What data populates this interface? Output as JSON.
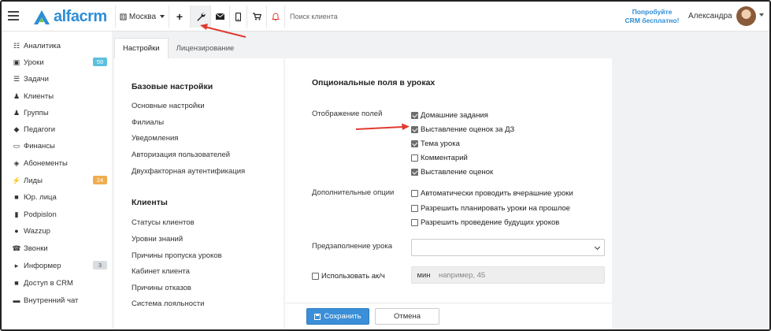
{
  "header": {
    "logo_text": "alfacrm",
    "city": "Москва",
    "search_placeholder": "Поиск клиента",
    "promo_line1": "Попробуйте",
    "promo_line2": "CRM бесплатно!",
    "user_name": "Александра"
  },
  "sidebar": {
    "items": [
      {
        "label": "Аналитика",
        "icon": "chart-book-icon"
      },
      {
        "label": "Уроки",
        "icon": "calendar-icon",
        "badge": "59",
        "badge_color": "#5bc0de"
      },
      {
        "label": "Задачи",
        "icon": "clipboard-icon"
      },
      {
        "label": "Клиенты",
        "icon": "user-icon"
      },
      {
        "label": "Группы",
        "icon": "users-icon"
      },
      {
        "label": "Педагоги",
        "icon": "graduation-cap-icon"
      },
      {
        "label": "Финансы",
        "icon": "money-icon"
      },
      {
        "label": "Абонементы",
        "icon": "tag-icon"
      },
      {
        "label": "Лиды",
        "icon": "lightning-icon",
        "badge": "24",
        "badge_color": "#f0ad4e"
      },
      {
        "label": "Юр. лица",
        "icon": "briefcase-icon"
      },
      {
        "label": "Podpislon",
        "icon": "document-icon"
      },
      {
        "label": "Wazzup",
        "icon": "whatsapp-icon"
      },
      {
        "label": "Звонки",
        "icon": "phone-icon"
      },
      {
        "label": "Информер",
        "icon": "megaphone-icon",
        "badge": "3",
        "badge_color": "#d9dde1"
      },
      {
        "label": "Доступ в CRM",
        "icon": "lock-icon"
      },
      {
        "label": "Внутренний чат",
        "icon": "chat-icon"
      }
    ]
  },
  "tabs": [
    "Настройки",
    "Лицензирование"
  ],
  "settings_nav": {
    "basic_title": "Базовые настройки",
    "basic_links": [
      "Основные настройки",
      "Филиалы",
      "Уведомления",
      "Авторизация пользователей",
      "Двухфакторная аутентификация"
    ],
    "clients_title": "Клиенты",
    "clients_links": [
      "Статусы клиентов",
      "Уровни знаний",
      "Причины пропуска уроков",
      "Кабинет клиента",
      "Причины отказов",
      "Система лояльности"
    ]
  },
  "content": {
    "section_title": "Опциональные поля в уроках",
    "display_label": "Отображение полей",
    "display_options": [
      {
        "label": "Домашние задания",
        "checked": true
      },
      {
        "label": "Выставление оценок за ДЗ",
        "checked": true
      },
      {
        "label": "Тема урока",
        "checked": true
      },
      {
        "label": "Комментарий",
        "checked": false
      },
      {
        "label": "Выставление оценок",
        "checked": true
      }
    ],
    "extra_label": "Дополнительные опции",
    "extra_options": [
      {
        "label": "Автоматически проводить вчерашние уроки",
        "checked": false
      },
      {
        "label": "Разрешить планировать уроки на прошлое",
        "checked": false
      },
      {
        "label": "Разрешить проведение будущих уроков",
        "checked": false
      }
    ],
    "prefill_label": "Предзаполнение урока",
    "prefill_value": "",
    "ak_label": "Использовать ак/ч",
    "ak_checked": false,
    "min_unit": "мин",
    "min_placeholder": "например, 45"
  },
  "footer": {
    "save_label": "Сохранить",
    "cancel_label": "Отмена"
  },
  "colors": {
    "brand": "#2d8ed6",
    "save_button": "#3a8fd8",
    "annotation_arrow": "#e03a2f"
  }
}
